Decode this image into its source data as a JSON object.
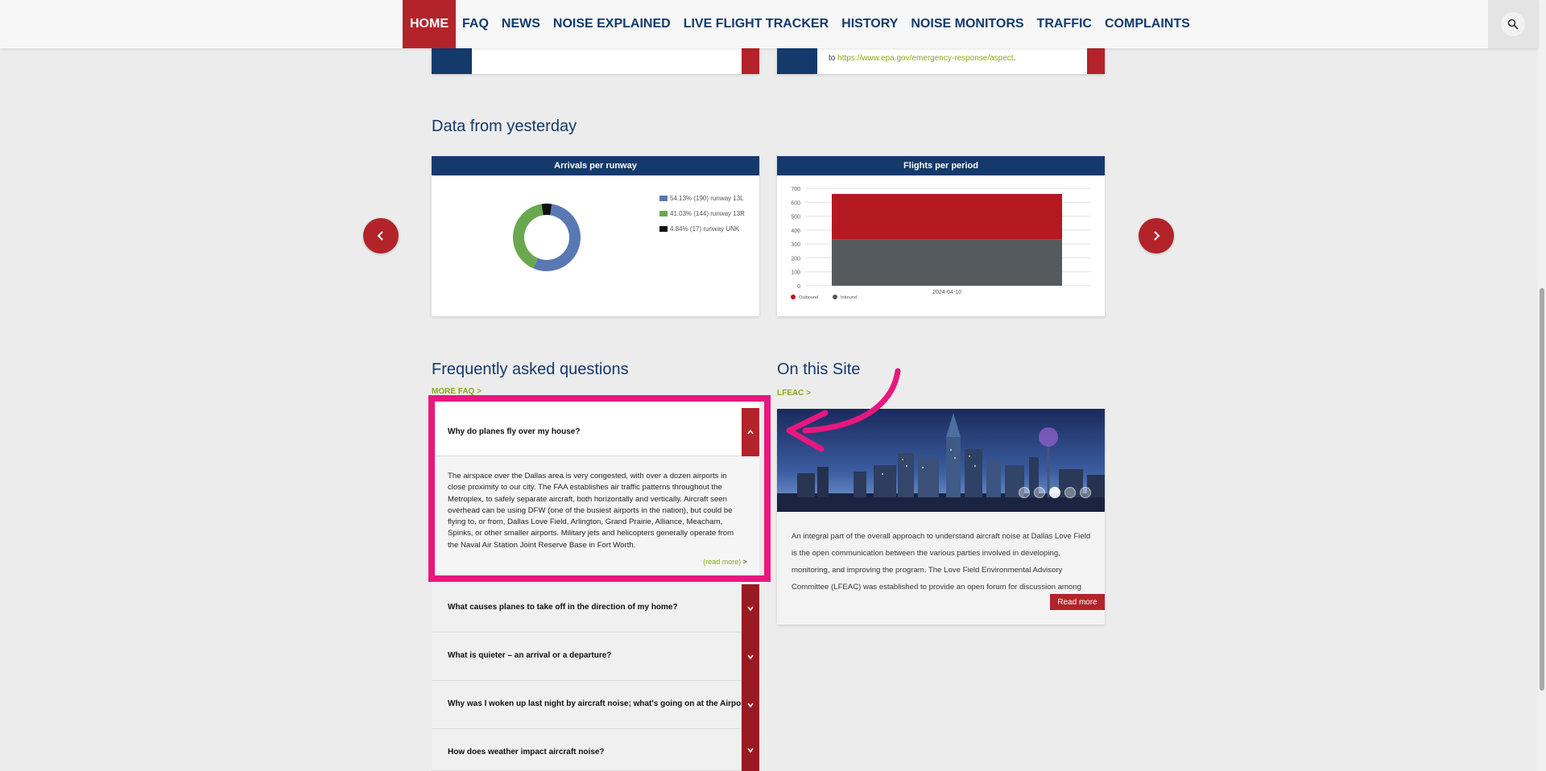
{
  "nav": {
    "items": [
      "HOME",
      "FAQ",
      "NEWS",
      "NOISE EXPLAINED",
      "LIVE FLIGHT TRACKER",
      "HISTORY",
      "NOISE MONITORS",
      "TRAFFIC",
      "COMPLAINTS"
    ],
    "active_index": 0,
    "search_icon": "search-icon"
  },
  "stub_link": {
    "prefix": "to ",
    "url": "https://www.epa.gov/emergency-response/aspect",
    "suffix": "."
  },
  "data_section": {
    "title": "Data from yesterday"
  },
  "chart_data": [
    {
      "type": "pie",
      "title": "Arrivals per runway",
      "donut": true,
      "slices": [
        {
          "label": "54.13% (190) runway 13L",
          "value": 190,
          "percent": 54.13,
          "color": "#5a78b4"
        },
        {
          "label": "41.03% (144) runway 13R",
          "value": 144,
          "percent": 41.03,
          "color": "#6aa84f"
        },
        {
          "label": "4.84% (17) runway UNK",
          "value": 17,
          "percent": 4.84,
          "color": "#111111"
        }
      ],
      "legend_placement": "top-right"
    },
    {
      "type": "bar",
      "title": "Flights per period",
      "stacked": true,
      "categories": [
        "2024-04-10"
      ],
      "series": [
        {
          "name": "Outbound",
          "values": [
            325
          ],
          "color": "#b3191f"
        },
        {
          "name": "Inbound",
          "values": [
            335
          ],
          "color": "#555a5e"
        }
      ],
      "yticks": [
        "0",
        "100",
        "200",
        "300",
        "400",
        "500",
        "600",
        "700"
      ],
      "ylim": [
        0,
        700
      ],
      "grid": true,
      "legend_placement": "bottom-left"
    }
  ],
  "faq": {
    "title": "Frequently asked questions",
    "more_link": "MORE FAQ >",
    "open_item": {
      "question": "Why do planes fly over my house?",
      "answer": "The airspace over the Dallas area is very congested, with over a dozen airports in close proximity to our city.  The FAA establishes air traffic patterns throughout the Metroplex, to safely separate aircraft, both horizontally and vertically. Aircraft seen overhead can be using DFW (one of the busiest airports in the nation), but could be flying to, or from, Dallas Love Field, Arlington, Grand Prairie, Alliance, Meacham, Spinks, or other smaller airports. Military jets and helicopters generally operate from the Naval Air Station Joint Reserve Base in Fort Worth.",
      "read_more": "(read more)",
      "read_more_suffix": " >"
    },
    "items": [
      "What causes planes to take off in the direction of my home?",
      "What is quieter – an arrival or a departure?",
      "Why was I woken up last night by aircraft noise; what's going on at the Airport?",
      "How does weather impact aircraft noise?"
    ]
  },
  "site": {
    "title": "On this Site",
    "link": "LFEAC >",
    "text": "An integral part of the overall approach to understand aircraft noise at Dallas Love Field is the open communication between the various parties involved in developing, monitoring, and improving the program. The Love Field Environmental Advisory Committee (LFEAC) was established to provide an open forum for discussion among",
    "read_more": "Read more",
    "slides": 5,
    "active_slide": 2
  },
  "colors": {
    "brand_blue": "#143a6c",
    "brand_red": "#b3232a",
    "accent_green": "#8aaa1e",
    "highlight": "#e8177f"
  }
}
